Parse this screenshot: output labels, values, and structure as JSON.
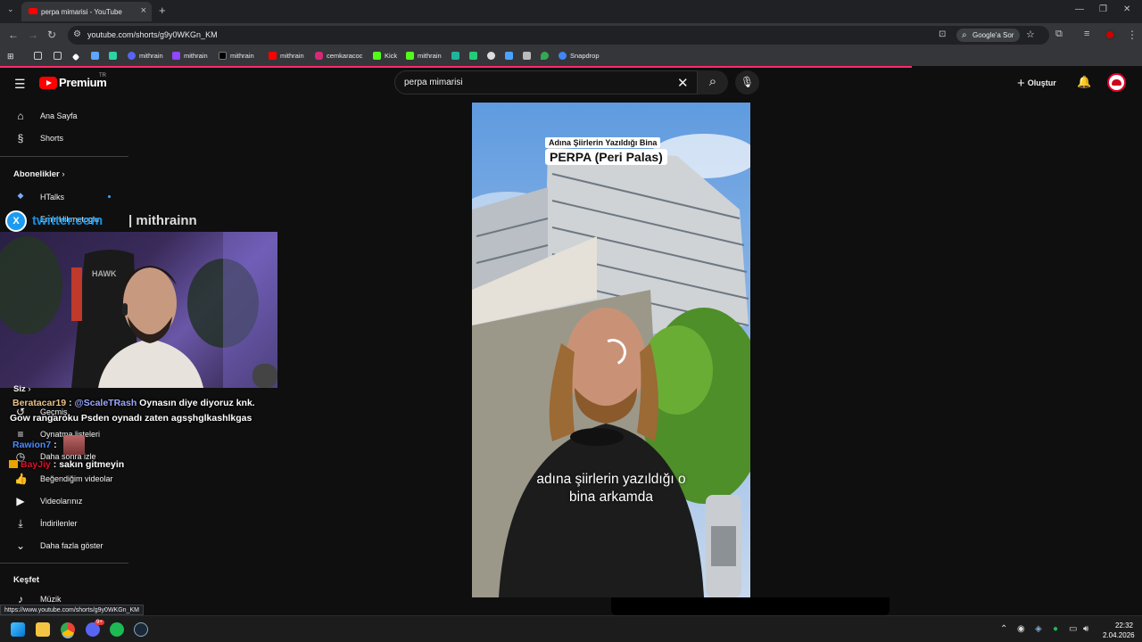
{
  "browser": {
    "tab_title": "perpa mimarisi - YouTube",
    "url": "youtube.com/shorts/g9y0WKGn_KM",
    "ask_google": "Google'a Sor",
    "status_url": "https://www.youtube.com/shorts/g9y0WKGn_KM",
    "bookmarks": [
      "mithrain",
      "mithrain",
      "mithrain",
      "mithrain",
      "cemkaracoc",
      "Kick",
      "mithrain",
      "Snapdrop"
    ]
  },
  "youtube": {
    "logo_text": "Premium",
    "logo_region": "TR",
    "search_value": "perpa mimarisi",
    "create_label": "Oluştur"
  },
  "sidebar": {
    "home": "Ana Sayfa",
    "shorts": "Shorts",
    "subscriptions_header": "Abonelikler",
    "sub_channel_1": "HTalks",
    "sub_channel_2": "Emir Hikmetoglu",
    "you_header": "Siz",
    "history": "Geçmiş",
    "playlists": "Oynatma listeleri",
    "watch_later": "Daha sonra izle",
    "liked_videos": "Beğendiğim videolar",
    "your_videos": "Videolarınız",
    "downloads": "İndirilenler",
    "show_more": "Daha fazla göster",
    "explore_header": "Keşfet",
    "music": "Müzik"
  },
  "overlay": {
    "twitter_domain": "twitter.com",
    "twitter_handle": "| mithrainn",
    "chat": [
      {
        "user": "Beratacar19",
        "sep": " : ",
        "mention": "@ScaleTRash",
        "text": " Oynasın diye diyoruz knk."
      },
      {
        "text": "Gow rangaroku Psden oynadı zaten agsşhglkashlkgas"
      },
      {
        "user": "Rawion7",
        "sep": " :"
      },
      {
        "user": "BayJiy",
        "sep": " : ",
        "text": "sakın gitmeyin"
      }
    ]
  },
  "video": {
    "title_small": "Adına Şiirlerin Yazıldığı Bina",
    "title_big": "PERPA (Peri Palas)",
    "caption_line1": "adına şiirlerin yazıldığı o",
    "caption_line2": "bina arkamda"
  },
  "taskbar": {
    "time": "22:32",
    "date": "2.04.2026",
    "discord_badge": "9+"
  },
  "colors": {
    "youtube_red": "#ff0000",
    "accent_pink": "#ff2a6d",
    "twitter_blue": "#1d9bf0"
  }
}
